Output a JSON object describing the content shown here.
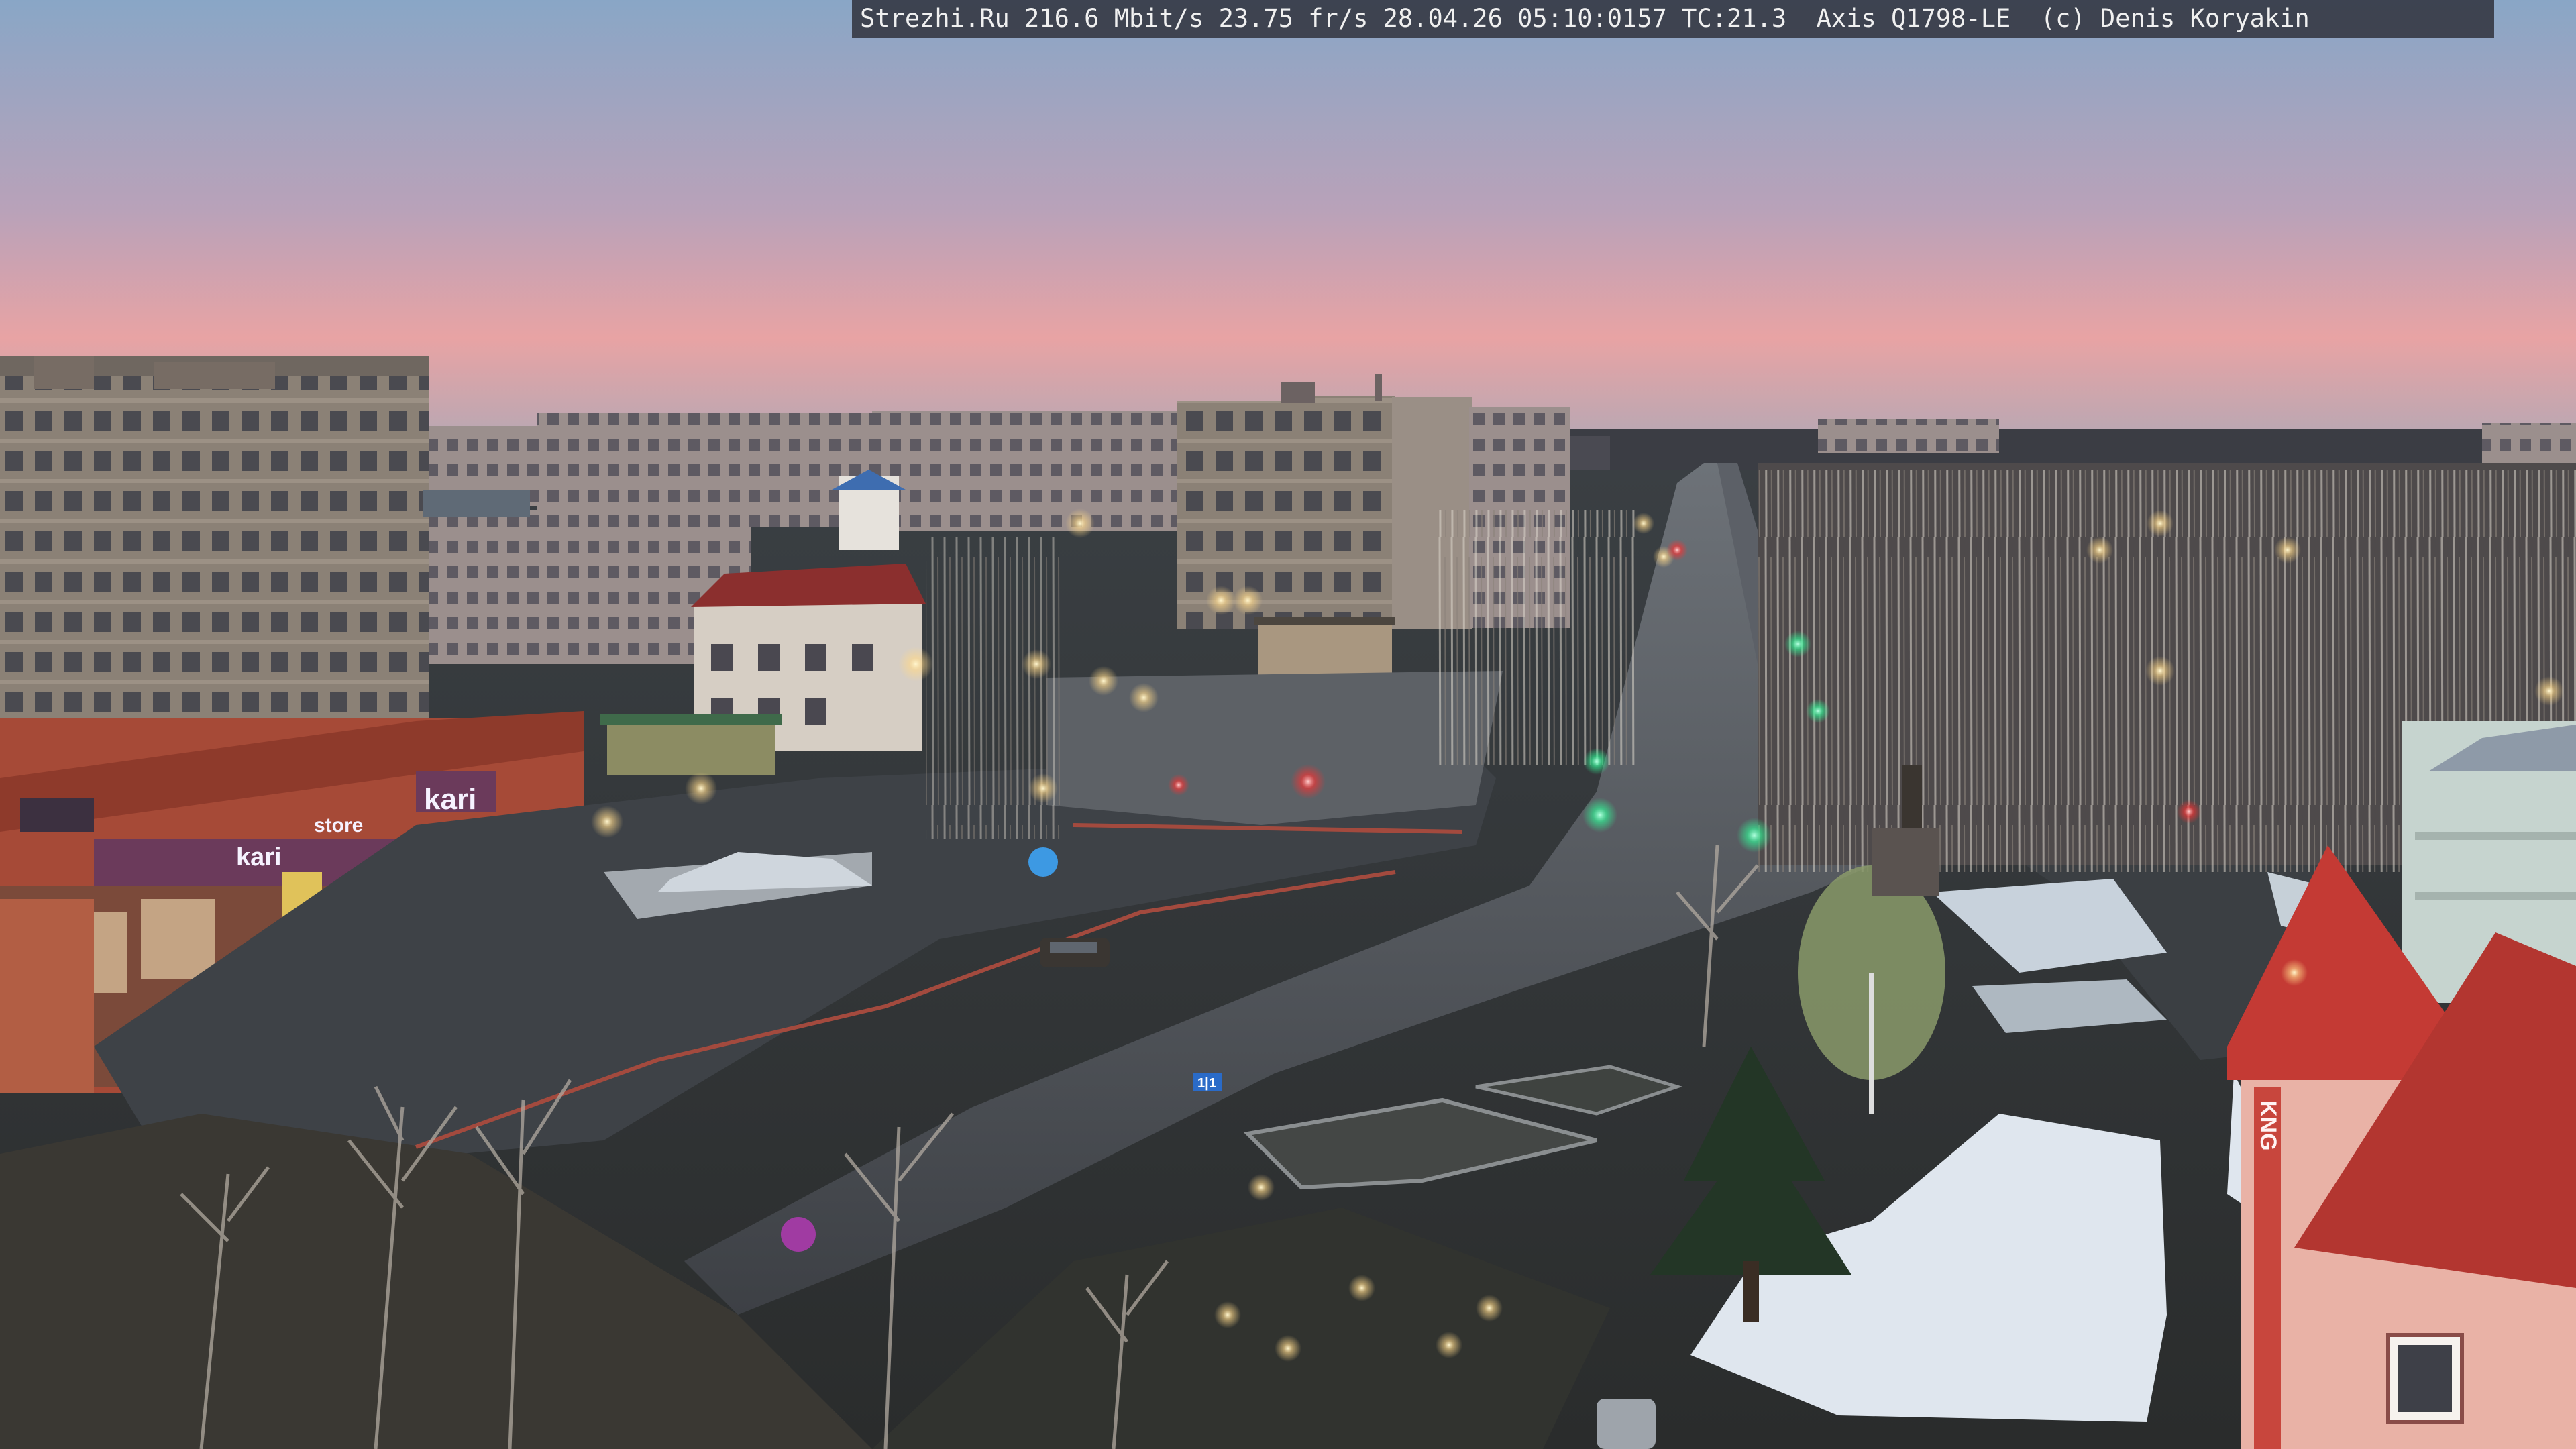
{
  "overlay": {
    "text": "Strezhi.Ru 216.6 Mbit/s 23.75 fr/s 28.04.26 05:10:0157 TC:21.3  Axis Q1798-LE  (c) Denis Koryakin"
  },
  "signs": {
    "kari_large": "kari",
    "kari_small": "kari",
    "store_small": "store",
    "road_info": "1|1",
    "right_building_vertical": "KNG"
  },
  "colors": {
    "sky_top": "#8fa6c4",
    "sky_mid": "#c7a3b6",
    "sky_horizon": "#f0a09a",
    "building_tan": "#8d8276",
    "storefront_red": "#b5563f",
    "roof_red": "#c43a34",
    "snow": "#dfe6ee",
    "asphalt": "#474a4f",
    "street_light": "#ffe9b0",
    "traffic_green": "#38ffa0",
    "traffic_red": "#ff3030"
  }
}
